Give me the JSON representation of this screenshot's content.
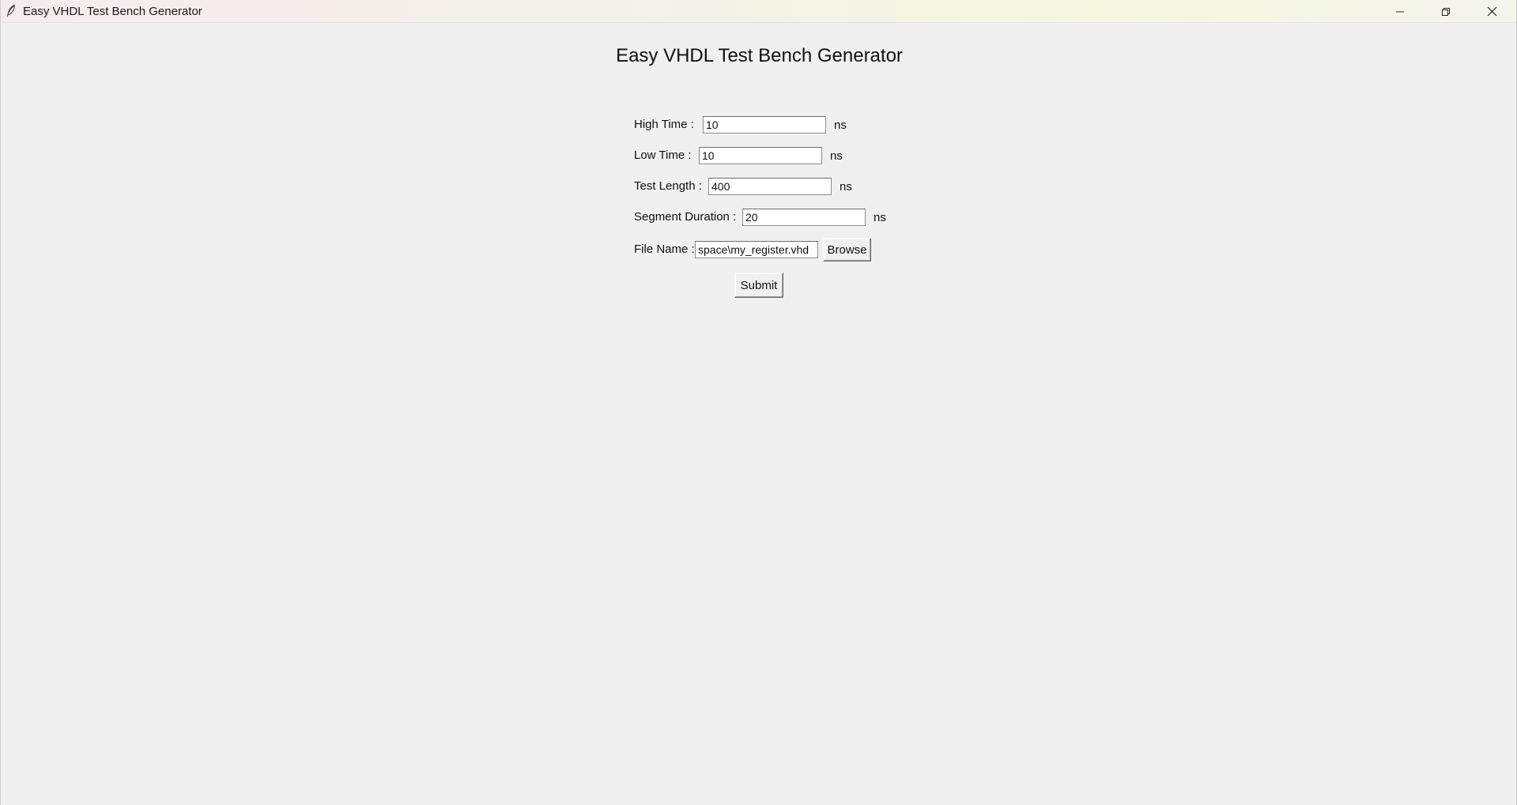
{
  "window": {
    "title": "Easy VHDL Test Bench Generator",
    "controls": {
      "minimize_icon": "minimize-icon",
      "maximize_icon": "restore-icon",
      "close_icon": "close-icon"
    }
  },
  "main": {
    "heading": "Easy VHDL Test Bench Generator",
    "fields": {
      "high_time": {
        "label": "High Time :",
        "value": "10",
        "unit": "ns"
      },
      "low_time": {
        "label": "Low Time :",
        "value": "10",
        "unit": "ns"
      },
      "test_length": {
        "label": "Test Length :",
        "value": "400",
        "unit": "ns"
      },
      "segment_duration": {
        "label": "Segment Duration :",
        "value": "20",
        "unit": "ns"
      },
      "file_name": {
        "label": "File Name :",
        "value": "space\\my_register.vhd"
      }
    },
    "browse_label": "Browse",
    "submit_label": "Submit"
  }
}
